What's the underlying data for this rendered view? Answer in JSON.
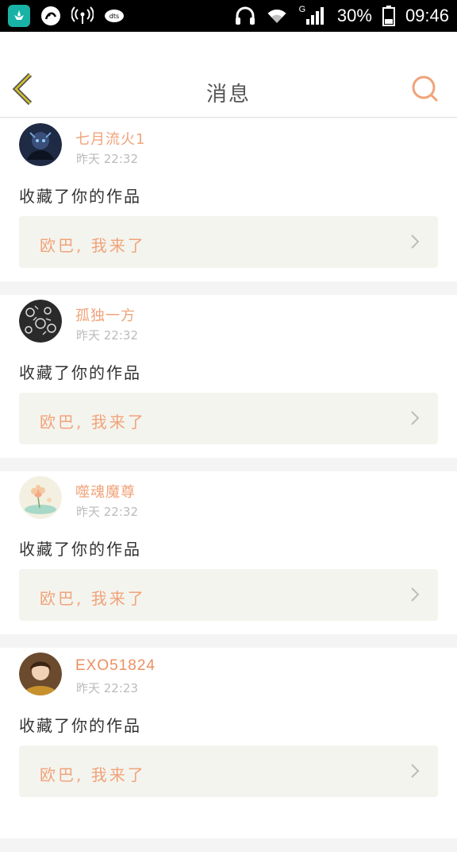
{
  "status_bar": {
    "battery": "30%",
    "time": "09:46",
    "network_label": "G"
  },
  "header": {
    "title": "消息",
    "accent_color": "#f0a37a"
  },
  "messages": [
    {
      "username": "七月流火1",
      "time": "昨天 22:32",
      "action": "收藏了你的作品",
      "work_title": "欧巴, 我来了",
      "avatar": "dark-anime-avatar"
    },
    {
      "username": "孤独一方",
      "time": "昨天 22:32",
      "action": "收藏了你的作品",
      "work_title": "欧巴, 我来了",
      "avatar": "pattern-avatar"
    },
    {
      "username": "噬魂魔尊",
      "time": "昨天 22:32",
      "action": "收藏了你的作品",
      "work_title": "欧巴, 我来了",
      "avatar": "flower-avatar"
    },
    {
      "username": "EXO51824",
      "time": "昨天 22:23",
      "action": "收藏了你的作品",
      "work_title": "欧巴, 我来了",
      "avatar": "person-avatar"
    }
  ]
}
